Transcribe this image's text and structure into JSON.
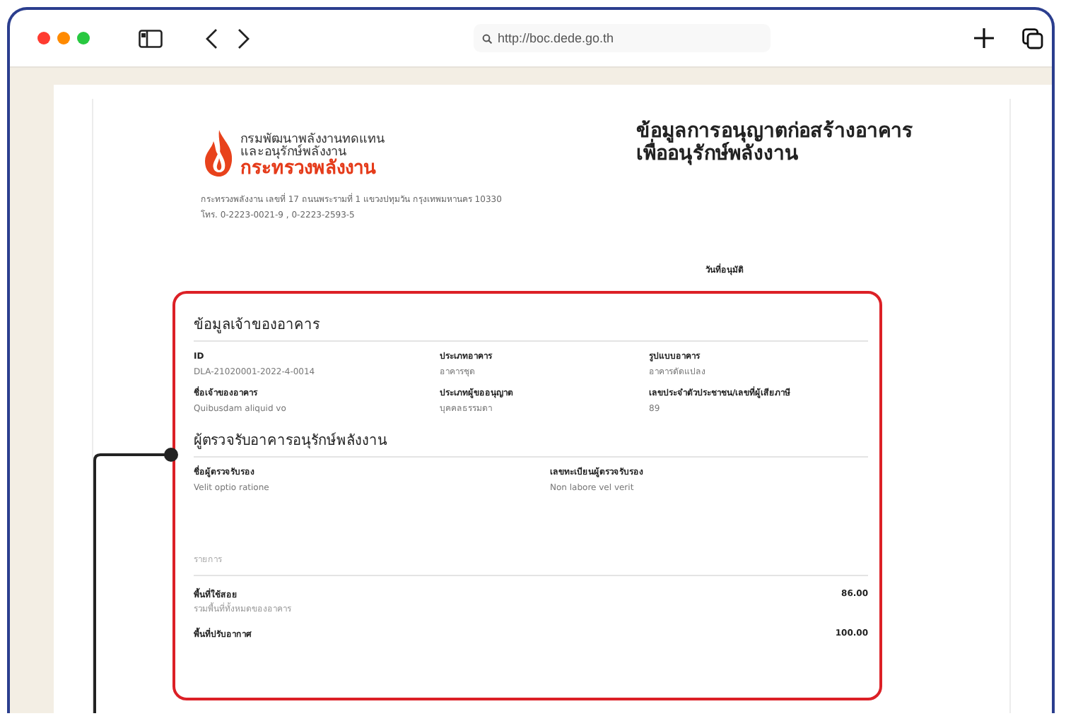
{
  "browser": {
    "url": "http://boc.dede.go.th"
  },
  "document": {
    "agency_lines": [
      "กรมพัฒนาพลังงานทดแทน",
      "และอนุรักษ์พลังงาน"
    ],
    "ministry": "กระทรวงพลังงาน",
    "address_lines": [
      "กระทรวงพลังงาน เลขที่ 17 ถนนพระรามที่ 1 แขวงปทุมวัน กรุงเทพมหานคร 10330",
      "โทร. 0-2223-0021-9 , 0-2223-2593-5"
    ],
    "title_lines": [
      "ข้อมูลการอนุญาตก่อสร้างอาคาร",
      "เพื่ออนุรักษ์พลังงาน"
    ],
    "approval_date_label": "วันที่อนุมัติ",
    "sections": [
      {
        "title": "ข้อมูลเจ้าของอาคาร",
        "fields": [
          {
            "label": "ID",
            "value": "DLA-21020001-2022-4-0014"
          },
          {
            "label": "ประเภทอาคาร",
            "value": "อาคารชุด"
          },
          {
            "label": "รูปแบบอาคาร",
            "value": "อาคารดัดแปลง"
          },
          {
            "label": "ชื่อเจ้าของอาคาร",
            "value": "Quibusdam aliquid vo"
          },
          {
            "label": "ประเภทผู้ขออนุญาต",
            "value": "บุคคลธรรมดา"
          },
          {
            "label": "เลขประจำตัวประชาชน/เลขที่ผู้เสียภาษี",
            "value": "89"
          }
        ]
      },
      {
        "title": "ผู้ตรวจรับอาคารอนุรักษ์พลังงาน",
        "fields": [
          {
            "label": "ชื่อผู้ตรวจรับรอง",
            "value": "Velit optio ratione"
          },
          {
            "label": "เลขทะเบียนผู้ตรวจรับรอง",
            "value": "Non labore vel verit"
          }
        ]
      }
    ],
    "items_header": "รายการ",
    "items": [
      {
        "label": "พื้นที่ใช้สอย",
        "note": "รวมพื้นที่ทั้งหมดของอาคาร",
        "value": "86.00"
      },
      {
        "label": "พื้นที่ปรับอากาศ",
        "value": "100.00"
      }
    ]
  }
}
